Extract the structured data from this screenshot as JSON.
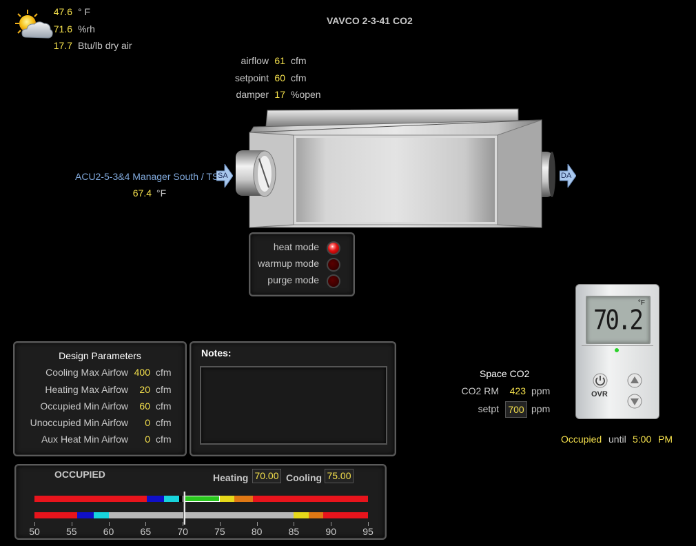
{
  "weather": {
    "icon": "partly-sunny-icon",
    "temp": "47.6",
    "temp_unit": "° F",
    "rh": "71.6",
    "rh_unit": "%rh",
    "enthalpy": "17.7",
    "enthalpy_unit": "Btu/lb dry air"
  },
  "title": "VAVCO 2-3-41 CO2",
  "box": {
    "airflow_label": "airflow",
    "airflow": "61",
    "airflow_unit": "cfm",
    "setpoint_label": "setpoint",
    "setpoint": "60",
    "setpoint_unit": "cfm",
    "damper_label": "damper",
    "damper": "17",
    "damper_unit": "%open"
  },
  "supply": {
    "source": "ACU2-5-3&4 Manager South / TSA",
    "temp": "67.4",
    "temp_unit": "°F",
    "inlet_tag": "SA",
    "outlet_tag": "DA"
  },
  "modes": [
    {
      "label": "heat mode",
      "on": true
    },
    {
      "label": "warmup mode",
      "on": false
    },
    {
      "label": "purge mode",
      "on": false
    }
  ],
  "design": {
    "title": "Design Parameters",
    "rows": [
      {
        "label": "Cooling Max Airfow",
        "value": "400",
        "unit": "cfm"
      },
      {
        "label": "Heating Max Airfow",
        "value": "20",
        "unit": "cfm"
      },
      {
        "label": "Occupied Min Airfow",
        "value": "60",
        "unit": "cfm"
      },
      {
        "label": "Unoccupied Min Airfow",
        "value": "0",
        "unit": "cfm"
      },
      {
        "label": "Aux Heat Min Airfow",
        "value": "0",
        "unit": "cfm"
      }
    ]
  },
  "notes": {
    "label": "Notes:"
  },
  "co2": {
    "title": "Space CO2",
    "rm_label": "CO2 RM",
    "rm_value": "423",
    "rm_unit": "ppm",
    "setpt_label": "setpt",
    "setpt_value": "700",
    "setpt_unit": "ppm"
  },
  "thermostat": {
    "display": "70.2",
    "unit": "°F",
    "ovr_label": "OVR",
    "power_icon": "power-icon",
    "up_icon": "up-triangle-icon",
    "down_icon": "down-triangle-icon"
  },
  "occupancy": {
    "status": "Occupied",
    "until_label": "until",
    "time": "5:00",
    "ampm": "PM"
  },
  "schedule": {
    "mode": "OCCUPIED",
    "heating_label": "Heating",
    "heating": "70.00",
    "cooling_label": "Cooling",
    "cooling": "75.00",
    "scale_min": 50,
    "scale_max": 95,
    "current_temp": 70.2,
    "ticks": [
      "50",
      "55",
      "60",
      "65",
      "70",
      "75",
      "80",
      "85",
      "90",
      "95"
    ],
    "occupied_bands": [
      {
        "from": 50,
        "to": 65.2,
        "color": "#e8141c"
      },
      {
        "from": 65.2,
        "to": 67.5,
        "color": "#1010c8"
      },
      {
        "from": 67.5,
        "to": 69.5,
        "color": "#18d4dc"
      },
      {
        "from": 69.5,
        "to": 70,
        "color": "#000000"
      },
      {
        "from": 70,
        "to": 75,
        "color": "#2ac81e"
      },
      {
        "from": 75,
        "to": 77,
        "color": "#e6d81a"
      },
      {
        "from": 77,
        "to": 79.5,
        "color": "#e07814"
      },
      {
        "from": 79.5,
        "to": 95,
        "color": "#e8141c"
      }
    ],
    "unoccupied_bands": [
      {
        "from": 50,
        "to": 55.8,
        "color": "#e8141c"
      },
      {
        "from": 55.8,
        "to": 58,
        "color": "#1010c8"
      },
      {
        "from": 58,
        "to": 60,
        "color": "#18d4dc"
      },
      {
        "from": 60,
        "to": 85,
        "color": "#b8b8b8"
      },
      {
        "from": 85,
        "to": 87,
        "color": "#e6d81a"
      },
      {
        "from": 87,
        "to": 89,
        "color": "#e07814"
      },
      {
        "from": 89,
        "to": 95,
        "color": "#e8141c"
      }
    ]
  }
}
